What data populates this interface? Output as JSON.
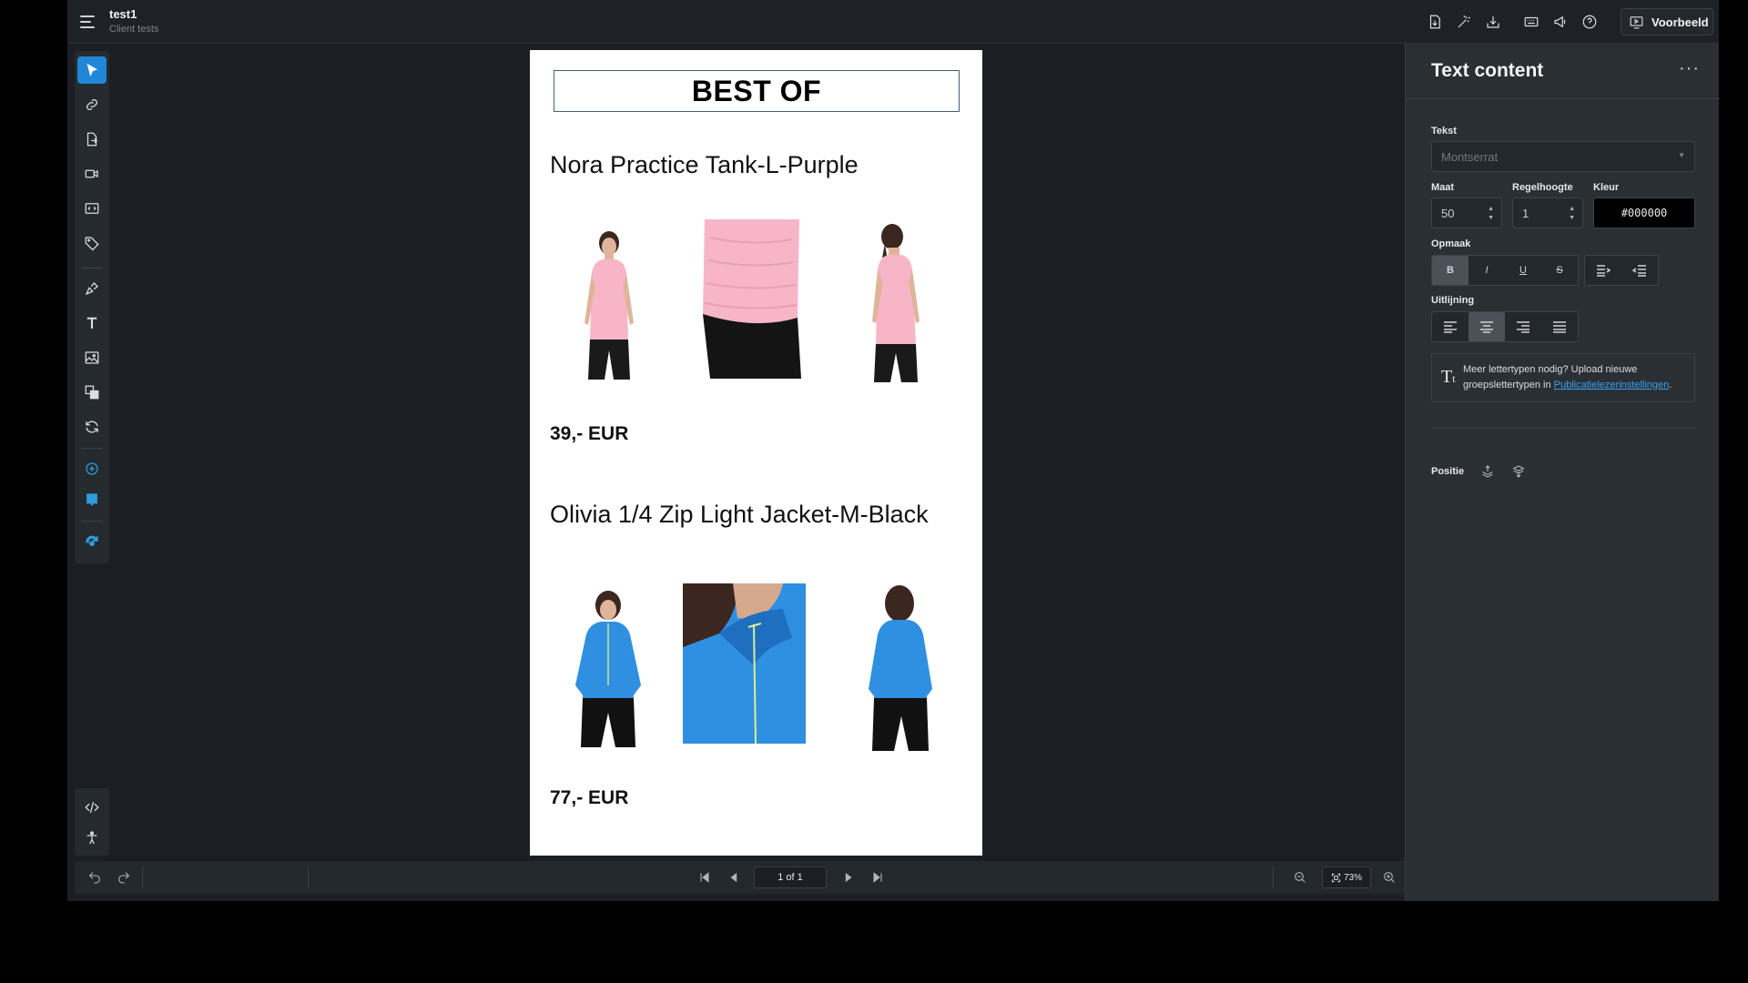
{
  "document": {
    "title": "test1",
    "subtitle": "Client tests"
  },
  "topbar": {
    "preview_label": "Voorbeeld"
  },
  "page": {
    "heading": "BEST OF",
    "products": [
      {
        "name": "Nora Practice Tank-L-Purple",
        "price": "39,- EUR",
        "color": "#f7b6c8"
      },
      {
        "name": "Olivia 1/4 Zip Light Jacket-M-Black",
        "price": "77,- EUR",
        "color": "#2f8fe0"
      }
    ]
  },
  "bottombar": {
    "page_indicator": "1 of 1",
    "zoom": "73%"
  },
  "panel": {
    "title": "Text content",
    "more_label": "···",
    "font_label": "Tekst",
    "font_value": "Montserrat",
    "size_label": "Maat",
    "size_value": "50",
    "lineheight_label": "Regelhoogte",
    "lineheight_value": "1",
    "color_label": "Kleur",
    "color_value": "#000000",
    "format_label": "Opmaak",
    "format_buttons": [
      "B",
      "I",
      "U",
      "S"
    ],
    "align_label": "Uitlijning",
    "info_text": "Meer lettertypen nodig? Upload nieuwe groepslettertypen in ",
    "info_link": "Publicatielezerinstellingen",
    "info_suffix": ".",
    "position_label": "Positie"
  }
}
